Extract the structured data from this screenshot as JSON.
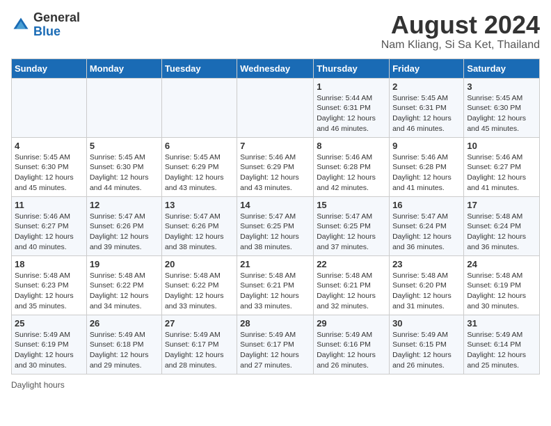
{
  "logo": {
    "general": "General",
    "blue": "Blue"
  },
  "title": "August 2024",
  "subtitle": "Nam Kliang, Si Sa Ket, Thailand",
  "days_of_week": [
    "Sunday",
    "Monday",
    "Tuesday",
    "Wednesday",
    "Thursday",
    "Friday",
    "Saturday"
  ],
  "weeks": [
    [
      {
        "day": "",
        "info": ""
      },
      {
        "day": "",
        "info": ""
      },
      {
        "day": "",
        "info": ""
      },
      {
        "day": "",
        "info": ""
      },
      {
        "day": "1",
        "info": "Sunrise: 5:44 AM\nSunset: 6:31 PM\nDaylight: 12 hours and 46 minutes."
      },
      {
        "day": "2",
        "info": "Sunrise: 5:45 AM\nSunset: 6:31 PM\nDaylight: 12 hours and 46 minutes."
      },
      {
        "day": "3",
        "info": "Sunrise: 5:45 AM\nSunset: 6:30 PM\nDaylight: 12 hours and 45 minutes."
      }
    ],
    [
      {
        "day": "4",
        "info": "Sunrise: 5:45 AM\nSunset: 6:30 PM\nDaylight: 12 hours and 45 minutes."
      },
      {
        "day": "5",
        "info": "Sunrise: 5:45 AM\nSunset: 6:30 PM\nDaylight: 12 hours and 44 minutes."
      },
      {
        "day": "6",
        "info": "Sunrise: 5:45 AM\nSunset: 6:29 PM\nDaylight: 12 hours and 43 minutes."
      },
      {
        "day": "7",
        "info": "Sunrise: 5:46 AM\nSunset: 6:29 PM\nDaylight: 12 hours and 43 minutes."
      },
      {
        "day": "8",
        "info": "Sunrise: 5:46 AM\nSunset: 6:28 PM\nDaylight: 12 hours and 42 minutes."
      },
      {
        "day": "9",
        "info": "Sunrise: 5:46 AM\nSunset: 6:28 PM\nDaylight: 12 hours and 41 minutes."
      },
      {
        "day": "10",
        "info": "Sunrise: 5:46 AM\nSunset: 6:27 PM\nDaylight: 12 hours and 41 minutes."
      }
    ],
    [
      {
        "day": "11",
        "info": "Sunrise: 5:46 AM\nSunset: 6:27 PM\nDaylight: 12 hours and 40 minutes."
      },
      {
        "day": "12",
        "info": "Sunrise: 5:47 AM\nSunset: 6:26 PM\nDaylight: 12 hours and 39 minutes."
      },
      {
        "day": "13",
        "info": "Sunrise: 5:47 AM\nSunset: 6:26 PM\nDaylight: 12 hours and 38 minutes."
      },
      {
        "day": "14",
        "info": "Sunrise: 5:47 AM\nSunset: 6:25 PM\nDaylight: 12 hours and 38 minutes."
      },
      {
        "day": "15",
        "info": "Sunrise: 5:47 AM\nSunset: 6:25 PM\nDaylight: 12 hours and 37 minutes."
      },
      {
        "day": "16",
        "info": "Sunrise: 5:47 AM\nSunset: 6:24 PM\nDaylight: 12 hours and 36 minutes."
      },
      {
        "day": "17",
        "info": "Sunrise: 5:48 AM\nSunset: 6:24 PM\nDaylight: 12 hours and 36 minutes."
      }
    ],
    [
      {
        "day": "18",
        "info": "Sunrise: 5:48 AM\nSunset: 6:23 PM\nDaylight: 12 hours and 35 minutes."
      },
      {
        "day": "19",
        "info": "Sunrise: 5:48 AM\nSunset: 6:22 PM\nDaylight: 12 hours and 34 minutes."
      },
      {
        "day": "20",
        "info": "Sunrise: 5:48 AM\nSunset: 6:22 PM\nDaylight: 12 hours and 33 minutes."
      },
      {
        "day": "21",
        "info": "Sunrise: 5:48 AM\nSunset: 6:21 PM\nDaylight: 12 hours and 33 minutes."
      },
      {
        "day": "22",
        "info": "Sunrise: 5:48 AM\nSunset: 6:21 PM\nDaylight: 12 hours and 32 minutes."
      },
      {
        "day": "23",
        "info": "Sunrise: 5:48 AM\nSunset: 6:20 PM\nDaylight: 12 hours and 31 minutes."
      },
      {
        "day": "24",
        "info": "Sunrise: 5:48 AM\nSunset: 6:19 PM\nDaylight: 12 hours and 30 minutes."
      }
    ],
    [
      {
        "day": "25",
        "info": "Sunrise: 5:49 AM\nSunset: 6:19 PM\nDaylight: 12 hours and 30 minutes."
      },
      {
        "day": "26",
        "info": "Sunrise: 5:49 AM\nSunset: 6:18 PM\nDaylight: 12 hours and 29 minutes."
      },
      {
        "day": "27",
        "info": "Sunrise: 5:49 AM\nSunset: 6:17 PM\nDaylight: 12 hours and 28 minutes."
      },
      {
        "day": "28",
        "info": "Sunrise: 5:49 AM\nSunset: 6:17 PM\nDaylight: 12 hours and 27 minutes."
      },
      {
        "day": "29",
        "info": "Sunrise: 5:49 AM\nSunset: 6:16 PM\nDaylight: 12 hours and 26 minutes."
      },
      {
        "day": "30",
        "info": "Sunrise: 5:49 AM\nSunset: 6:15 PM\nDaylight: 12 hours and 26 minutes."
      },
      {
        "day": "31",
        "info": "Sunrise: 5:49 AM\nSunset: 6:14 PM\nDaylight: 12 hours and 25 minutes."
      }
    ]
  ],
  "footer": "Daylight hours"
}
